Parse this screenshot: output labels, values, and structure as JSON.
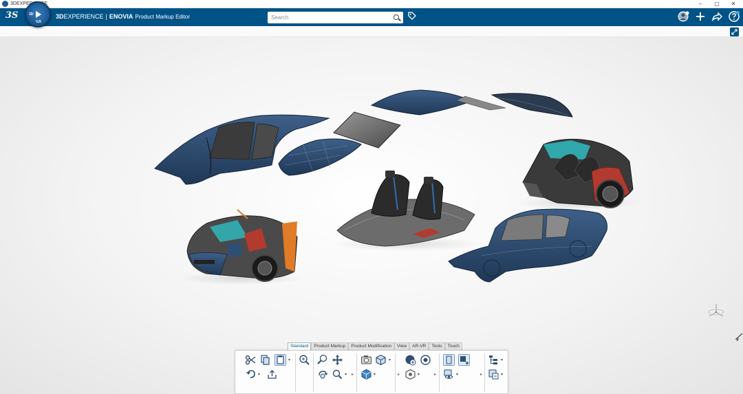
{
  "window": {
    "title": "3DEXPERIENCE",
    "minimize": "–",
    "maximize": "▢",
    "close": "✕"
  },
  "topbar": {
    "logo": "3S",
    "compass_3d": "3D",
    "compass_vr": "V,R",
    "brand_3d": "3D",
    "brand_experience": "EXPERIENCE",
    "brand_separator": "|",
    "brand_enovia": "ENOVIA",
    "brand_app": "Product Markup Editor",
    "search_placeholder": "Search",
    "icons": [
      "user-avatar-icon",
      "plus-icon",
      "share-icon",
      "help-icon"
    ]
  },
  "actionbar": {
    "tabs": [
      {
        "label": "Standard",
        "active": true
      },
      {
        "label": "Product Markup",
        "active": false
      },
      {
        "label": "Product Modification",
        "active": false
      },
      {
        "label": "View",
        "active": false
      },
      {
        "label": "AR-VR",
        "active": false
      },
      {
        "label": "Tools",
        "active": false
      },
      {
        "label": "Touch",
        "active": false
      }
    ]
  },
  "colors": {
    "brand_blue": "#005386",
    "panel_blue": "#2f4e73",
    "seat_dark": "#2b2b2b",
    "accent_red": "#b33a2f",
    "accent_cyan": "#2ec4c9",
    "accent_orange": "#e07b28"
  }
}
